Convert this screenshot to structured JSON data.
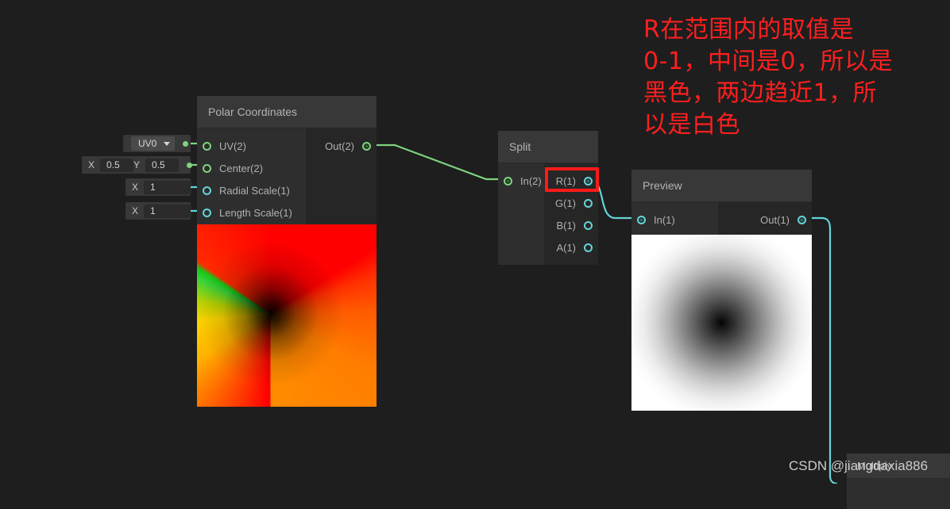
{
  "theme": {
    "canvas_bg": "#1e1e1e",
    "node_header_bg": "#383838",
    "node_body_bg": "#262626",
    "vector_port_color": "#7fd37f",
    "float_port_color": "#64d4d8",
    "highlight_color": "#ff1a1a",
    "annotation_color": "#ff1f1f"
  },
  "nodes": {
    "polar": {
      "title": "Polar Coordinates",
      "inputs": [
        {
          "label": "UV(2)",
          "type": "vector"
        },
        {
          "label": "Center(2)",
          "type": "vector"
        },
        {
          "label": "Radial Scale(1)",
          "type": "float"
        },
        {
          "label": "Length Scale(1)",
          "type": "float"
        }
      ],
      "outputs": [
        {
          "label": "Out(2)",
          "type": "vector"
        }
      ],
      "properties": [
        {
          "kind": "dropdown",
          "value": "UV0",
          "port_type": "vector"
        },
        {
          "kind": "vector2",
          "axis_x": "X",
          "value_x": "0.5",
          "axis_y": "Y",
          "value_y": "0.5",
          "port_type": "vector"
        },
        {
          "kind": "float",
          "axis_x": "X",
          "value_x": "1",
          "port_type": "float"
        },
        {
          "kind": "float",
          "axis_x": "X",
          "value_x": "1",
          "port_type": "float"
        }
      ],
      "preview_alt": "polar coordinates gradient preview"
    },
    "split": {
      "title": "Split",
      "inputs": [
        {
          "label": "In(2)",
          "type": "vector"
        }
      ],
      "outputs": [
        {
          "label": "R(1)",
          "type": "float",
          "connected": true
        },
        {
          "label": "G(1)",
          "type": "float",
          "connected": false
        },
        {
          "label": "B(1)",
          "type": "float",
          "connected": false
        },
        {
          "label": "A(1)",
          "type": "float",
          "connected": false
        }
      ]
    },
    "preview": {
      "title": "Preview",
      "inputs": [
        {
          "label": "In(1)",
          "type": "float"
        }
      ],
      "outputs": [
        {
          "label": "Out(1)",
          "type": "float"
        }
      ],
      "preview_alt": "radial black-to-white gradient preview"
    },
    "multiply": {
      "title": "Multiply"
    }
  },
  "annotation": {
    "text": "R在范围内的取值是\n0-1，中间是0，所以是\n黑色，两边趋近1，所\n以是白色"
  },
  "watermark": {
    "text": "CSDN @jiangdaxia886"
  }
}
